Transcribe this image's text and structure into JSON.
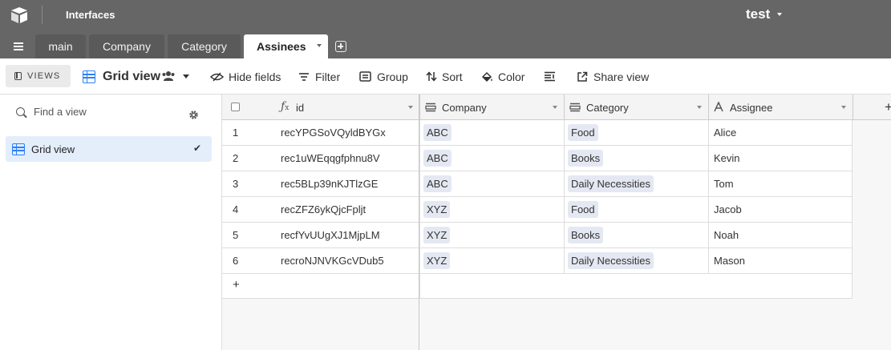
{
  "topbar": {
    "interfaces_label": "Interfaces",
    "base_name": "test"
  },
  "tabs": [
    {
      "label": "main",
      "active": false
    },
    {
      "label": "Company",
      "active": false
    },
    {
      "label": "Category",
      "active": false
    },
    {
      "label": "Assinees",
      "active": true
    }
  ],
  "viewbar": {
    "views_label": "VIEWS",
    "current_view": "Grid view",
    "hide_fields": "Hide fields",
    "filter": "Filter",
    "group": "Group",
    "sort": "Sort",
    "color": "Color",
    "share_view": "Share view"
  },
  "sidebar": {
    "find_placeholder": "Find a view",
    "views": [
      {
        "label": "Grid view",
        "selected": true
      }
    ]
  },
  "table": {
    "columns": [
      {
        "label": "id",
        "icon": "formula-icon"
      },
      {
        "label": "Company",
        "icon": "link-icon"
      },
      {
        "label": "Category",
        "icon": "link-icon"
      },
      {
        "label": "Assignee",
        "icon": "text-icon"
      }
    ],
    "rows": [
      {
        "num": "1",
        "id": "recYPGSoVQyldBYGx",
        "company": "ABC",
        "category": "Food",
        "assignee": "Alice"
      },
      {
        "num": "2",
        "id": "rec1uWEqqgfphnu8V",
        "company": "ABC",
        "category": "Books",
        "assignee": "Kevin"
      },
      {
        "num": "3",
        "id": "rec5BLp39nKJTlzGE",
        "company": "ABC",
        "category": "Daily Necessities",
        "assignee": "Tom"
      },
      {
        "num": "4",
        "id": "recZFZ6ykQjcFpljt",
        "company": "XYZ",
        "category": "Food",
        "assignee": "Jacob"
      },
      {
        "num": "5",
        "id": "recfYvUUgXJ1MjpLM",
        "company": "XYZ",
        "category": "Books",
        "assignee": "Noah"
      },
      {
        "num": "6",
        "id": "recroNJNVKGcVDub5",
        "company": "XYZ",
        "category": "Daily Necessities",
        "assignee": "Mason"
      }
    ],
    "add_row_label": "+",
    "add_field_label": "+"
  },
  "colors": {
    "topbar": "#666666",
    "accent": "#2d7ff9",
    "selected_view_bg": "#e4eefb",
    "tag_bg": "#e4e8f2"
  }
}
